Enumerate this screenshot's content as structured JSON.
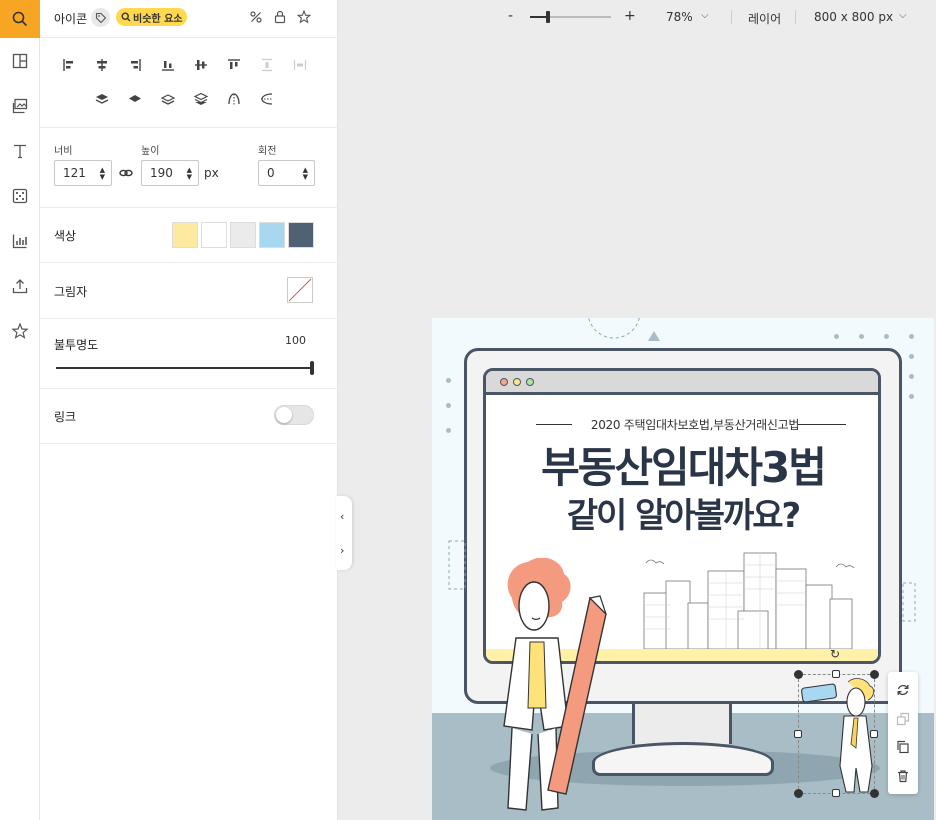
{
  "rail": {
    "items": [
      {
        "icon": "search-icon",
        "active": true
      },
      {
        "icon": "template-icon"
      },
      {
        "icon": "image-icon"
      },
      {
        "icon": "text-icon"
      },
      {
        "icon": "elements-icon"
      },
      {
        "icon": "chart-icon"
      },
      {
        "icon": "upload-icon"
      },
      {
        "icon": "star-icon"
      }
    ]
  },
  "panel": {
    "title": "아이콘",
    "similar_label": "비슷한 요소",
    "size": {
      "width_label": "너비",
      "width_value": "121",
      "height_label": "높이",
      "height_value": "190",
      "unit": "px",
      "rotation_label": "회전",
      "rotation_value": "0"
    },
    "color": {
      "label": "색상",
      "swatches": [
        "#fde9a0",
        "#ffffff",
        "#ebebeb",
        "#a8d7f0",
        "#4f6172"
      ]
    },
    "shadow_label": "그림자",
    "opacity": {
      "label": "불투명도",
      "value": "100"
    },
    "link_label": "링크"
  },
  "topbar": {
    "zoom_minus": "-",
    "zoom_plus": "+",
    "zoom_value": "78%",
    "layer_label": "레이어",
    "canvas_size": "800 x 800 px"
  },
  "canvas": {
    "subtitle": "2020 주택임대차보호법,부동산거래신고법",
    "headline_line1": "부동산임대차3법",
    "headline_line2": "같이 알아볼까요?",
    "colors": {
      "background": "#f2fafd",
      "floor": "#a9bdc6",
      "ink": "#2b3548"
    }
  }
}
